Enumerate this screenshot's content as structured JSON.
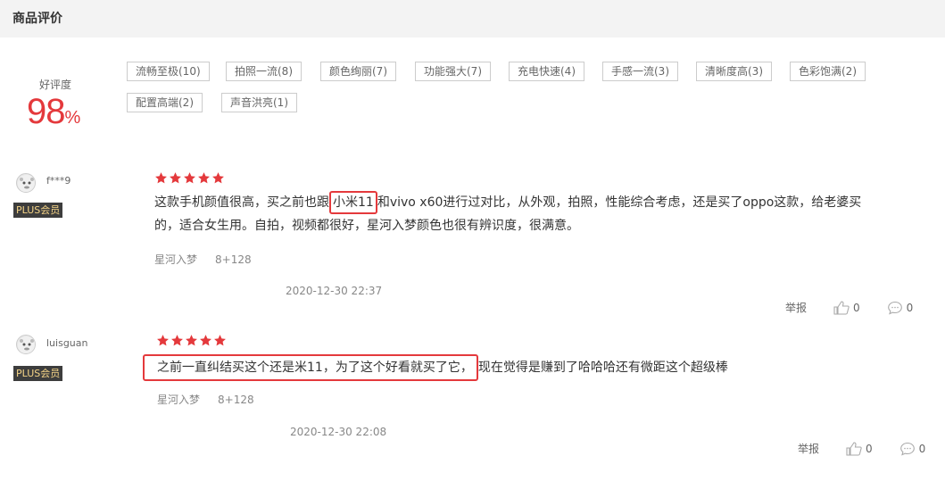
{
  "header": {
    "title": "商品评价"
  },
  "score": {
    "label": "好评度",
    "value": "98",
    "unit": "%"
  },
  "tags": [
    "流畅至极(10)",
    "拍照一流(8)",
    "颜色绚丽(7)",
    "功能强大(7)",
    "充电快速(4)",
    "手感一流(3)",
    "清晰度高(3)",
    "色彩饱满(2)",
    "配置高端(2)",
    "声音洪亮(1)"
  ],
  "reviews": [
    {
      "user": "f***9",
      "badge": "PLUS会员",
      "rating": 5,
      "text_part1": "这款手机颜值很高，买之前也跟",
      "text_highlight": "小米11",
      "text_part2": "和vivo x60进行过对比，从外观，拍照，性能综合考虑，还是买了oppo这款，给老婆买",
      "text_line2": "的，适合女生用。自拍，视频都很好，星河入梦颜色也很有辨识度，很满意。",
      "color": "星河入梦",
      "spec": "8+128",
      "time": "2020-12-30 22:37",
      "report": "举报",
      "likes": "0",
      "comments": "0"
    },
    {
      "user": "luisguan",
      "badge": "PLUS会员",
      "rating": 5,
      "text_highlight": "之前一直纠结买这个还是米11，为了这个好看就买了它，",
      "text_rest": "现在觉得是赚到了哈哈哈还有微距这个超级棒",
      "color": "星河入梦",
      "spec": "8+128",
      "time": "2020-12-30 22:08",
      "report": "举报",
      "likes": "0",
      "comments": "0"
    }
  ],
  "colors": {
    "accent": "#e4393c",
    "badge_bg": "#3d3d3d",
    "badge_text": "#f5d487"
  }
}
